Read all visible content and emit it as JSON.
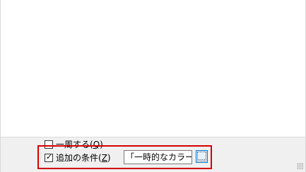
{
  "options": {
    "wrap_label": "一周する(",
    "wrap_key": "Q",
    "wrap_label_end": ")",
    "wrap_checked": false,
    "cond_label": "追加の条件(",
    "cond_key": "Z",
    "cond_label_end": ")",
    "cond_checked": true,
    "cond_value": "「一時的なカラー」",
    "browse_label": "...."
  },
  "icons": {
    "check": "checkmark-icon",
    "resize": "resize-grip-icon"
  },
  "colors": {
    "highlight_box": "#d40000",
    "button_border": "#0078d7",
    "panel_background": "#f0f0f0"
  }
}
